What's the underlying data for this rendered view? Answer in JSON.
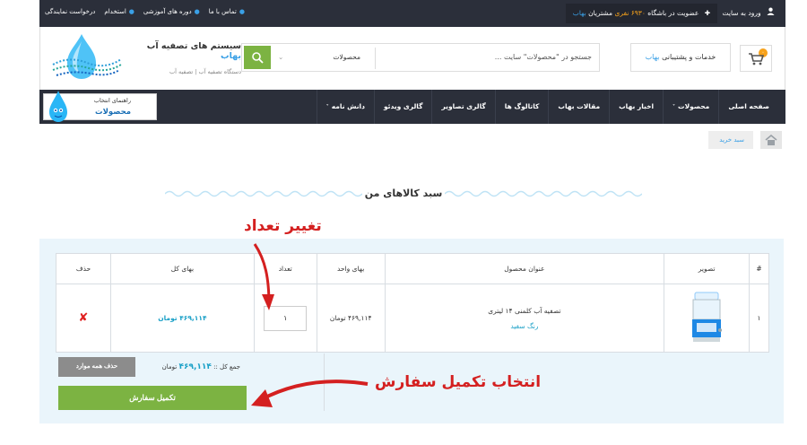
{
  "topbar": {
    "links": [
      "درخواست نمایندگی",
      "استخدام",
      "دوره های آموزشی",
      "تماس با ما"
    ],
    "join_prefix": "عضویت در باشگاه",
    "join_count": "۶۹۳۰ نفری",
    "join_mid": "مشتریان",
    "join_brand": "بهاب",
    "login": "ورود به سایت"
  },
  "header": {
    "logo_title_prefix": "سیستم های تصفیه آب",
    "logo_title_brand": "بهاب",
    "logo_subtitle": "دستگاه تصفیه آب | تصفیه آب",
    "services_prefix": "خدمات و پشتیبانی",
    "services_brand": "بهاب",
    "cart_count": "۰",
    "search_placeholder": "جستجو در \"محصولات\" سایت ...",
    "search_category": "محصولات"
  },
  "nav": {
    "items": [
      {
        "label": "صفحه اصلی",
        "has_chevron": false
      },
      {
        "label": "محصولات",
        "has_chevron": true
      },
      {
        "label": "اخبار بهاب",
        "has_chevron": false
      },
      {
        "label": "مقالات بهاب",
        "has_chevron": false
      },
      {
        "label": "کاتالوگ ها",
        "has_chevron": false
      },
      {
        "label": "گالری تصاویر",
        "has_chevron": false
      },
      {
        "label": "گالری ویدئو",
        "has_chevron": false
      },
      {
        "label": "دانش نامه",
        "has_chevron": true
      }
    ],
    "guide_line1": "راهنمای انتخاب",
    "guide_line2": "محصولات",
    "chevron": "˅"
  },
  "breadcrumb": {
    "current": "سبد خرید"
  },
  "section_title": "سبد کالاهای من",
  "annotations": {
    "change_quantity": "تغییر تعداد",
    "choose_checkout": "انتخاب تکمیل سفارش"
  },
  "cart": {
    "headers": {
      "index": "#",
      "image": "تصویر",
      "title": "عنوان محصول",
      "unit_price": "بهای واحد",
      "quantity": "تعداد",
      "total": "بهای کل",
      "delete": "حذف"
    },
    "rows": [
      {
        "index": "۱",
        "title": "تصفیه آب کلمنی ۱۴ لیتری",
        "variant": "رنگ سفید",
        "unit_price": "۴۶۹,۱۱۴ تومان",
        "quantity": "۱",
        "total": "۴۶۹,۱۱۴ تومان",
        "delete_symbol": "✘"
      }
    ],
    "sum_label": "جمع کل :: ",
    "sum_value": "۴۶۹,۱۱۴",
    "sum_unit": " تومان",
    "clear_all": "حذف همه موارد",
    "checkout": "تکمیل سفارش"
  },
  "colors": {
    "accent_blue": "#3aa0e6",
    "green": "#7cb342",
    "dark_bar": "#2b2f3a",
    "annotation_red": "#d42020"
  }
}
